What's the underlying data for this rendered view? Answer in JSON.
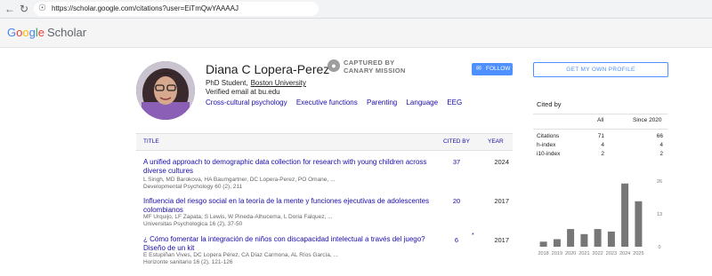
{
  "browser": {
    "url": "https://scholar.google.com/citations?user=EiTmQwYAAAAJ"
  },
  "header": {
    "logo_google": [
      "G",
      "o",
      "o",
      "g",
      "l",
      "e"
    ],
    "logo_scholar": "Scholar"
  },
  "profile": {
    "name": "Diana C Lopera-Perez",
    "captured_line1": "CAPTURED BY",
    "captured_line2": "CANARY MISSION",
    "role": "PhD Student,",
    "affiliation": "Boston University",
    "email": "Verified email at bu.edu",
    "interests": [
      "Cross-cultural psychology",
      "Executive functions",
      "Parenting",
      "Language",
      "EEG"
    ],
    "follow_label": "FOLLOW",
    "get_profile_label": "GET MY OWN PROFILE"
  },
  "table": {
    "col_title": "TITLE",
    "col_cited": "CITED BY",
    "col_year": "YEAR",
    "rows": [
      {
        "title": "A unified approach to demographic data collection for research with young children across diverse cultures",
        "authors": "L Singh, MD Barokova, HA Baumgartner, DC Lopera-Perez, PO Omane, ...",
        "venue": "Developmental Psychology 60 (2), 211",
        "cited": "37",
        "star": "",
        "year": "2024"
      },
      {
        "title": "Influencia del riesgo social en la teoría de la mente y funciones ejecutivas de adolescentes colombianos",
        "authors": "MF Urquijo, LF Zapata, S Lewis, W Pineda-Alhucema, L Doria Falquez, ...",
        "venue": "Universitas Psychologica 16 (2), 37-50",
        "cited": "20",
        "star": "",
        "year": "2017"
      },
      {
        "title": "¿ Cómo fomentar la integración de niños con discapacidad intelectual a través del juego? Diseño de un kit",
        "authors": "E Estupiñan Vives, DC Lopera Pérez, CA Díaz Carmona, AL Ríos García, ...",
        "venue": "Horizonte sanitario 16 (2), 121-126",
        "cited": "6",
        "star": "*",
        "year": "2017"
      }
    ]
  },
  "cited_by": {
    "title": "Cited by",
    "col_all": "All",
    "col_since": "Since 2020",
    "stats": [
      {
        "label": "Citations",
        "all": "71",
        "since": "66"
      },
      {
        "label": "h-index",
        "all": "4",
        "since": "4"
      },
      {
        "label": "i10-index",
        "all": "2",
        "since": "2"
      }
    ]
  },
  "chart_data": {
    "type": "bar",
    "categories": [
      "2018",
      "2019",
      "2020",
      "2021",
      "2022",
      "2023",
      "2024",
      "2025"
    ],
    "values": [
      2,
      3,
      7,
      5,
      7,
      6,
      25,
      18
    ],
    "ylim": [
      0,
      26
    ],
    "yticks": [
      "26",
      "13",
      "0"
    ],
    "bar_color": "#777777",
    "grid": false
  }
}
